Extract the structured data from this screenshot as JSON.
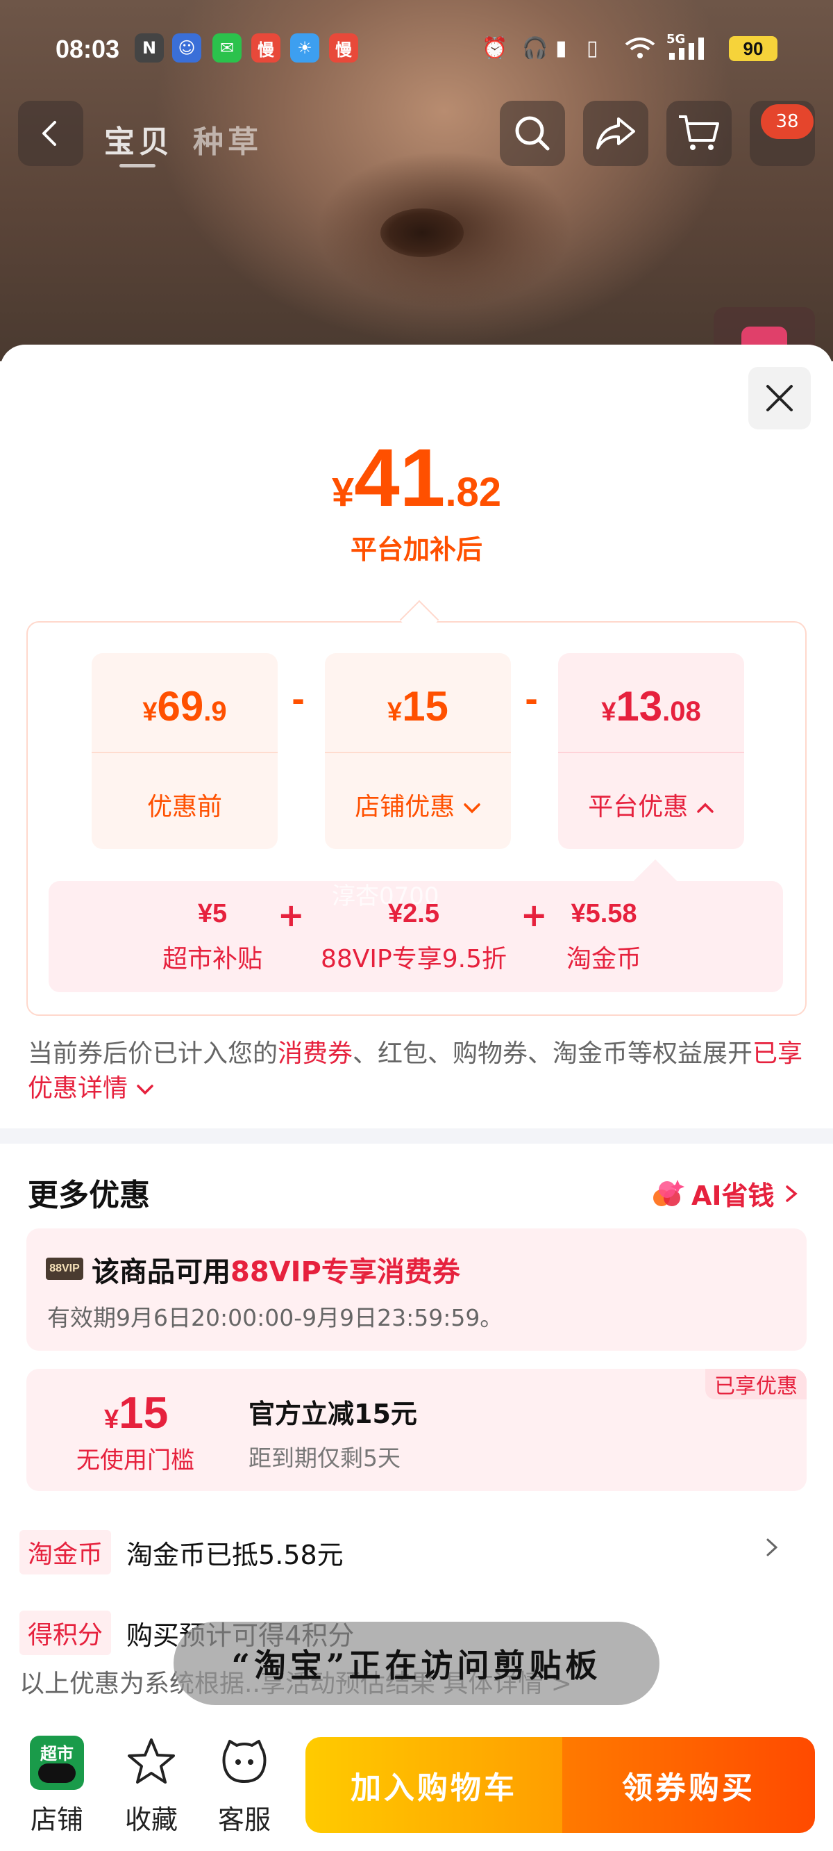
{
  "status_bar": {
    "time": "08:03",
    "app_icons": [
      "nfc-icon",
      "kids-app-icon",
      "wechat-icon",
      "manman-app-icon",
      "weather-icon",
      "manman-app-icon"
    ],
    "battery": "90",
    "network": "5G"
  },
  "header": {
    "tabs": [
      {
        "label": "宝贝",
        "active": true
      },
      {
        "label": "种草",
        "active": false
      }
    ],
    "cart_badge": "38"
  },
  "price": {
    "currency": "¥",
    "integer": "41",
    "decimal": ".82",
    "subtitle": "平台加补后"
  },
  "breakdown": {
    "cards": [
      {
        "currency": "¥",
        "integer": "69",
        "decimal": ".9",
        "label": "优惠前"
      },
      {
        "currency": "¥",
        "integer": "15",
        "decimal": "",
        "label": "店铺优惠"
      },
      {
        "currency": "¥",
        "integer": "13",
        "decimal": ".08",
        "label": "平台优惠"
      }
    ],
    "operator": "-",
    "subsidies": [
      {
        "value": "¥5",
        "name": "超市补贴"
      },
      {
        "value": "¥2.5",
        "name": "88VIP专享9.5折"
      },
      {
        "value": "¥5.58",
        "name": "淘金币"
      }
    ],
    "plus": "+",
    "watermark": "淳杏0700"
  },
  "note": {
    "part1": "当前券后价已计入您的",
    "highlight1": "消费券",
    "part2": "、红包、购物券、淘金币等权益展开",
    "highlight2": "已享优惠详情"
  },
  "more": {
    "title": "更多优惠",
    "ai_label": "AI省钱",
    "vip_badge": "88VIP",
    "vip_title_prefix": "该商品可用",
    "vip_title_highlight": "88VIP专享消费券",
    "vip_validity": "有效期9月6日20:00:00-9月9日23:59:59。",
    "coupon": {
      "currency": "¥",
      "amount": "15",
      "condition": "无使用门槛",
      "title": "官方立减15元",
      "expiry": "距到期仅剩5天",
      "tag": "已享优惠"
    },
    "rows": [
      {
        "tag": "淘金币",
        "text": "淘金币已抵5.58元"
      },
      {
        "tag": "得积分",
        "text": "购买预计可得4积分"
      }
    ],
    "footnote": "以上优惠为系统根据..享活动预估结果 具体详情 >"
  },
  "toast": "“淘宝”正在访问剪贴板",
  "bottom_bar": {
    "items": [
      {
        "label": "店铺",
        "icon": "tmall-supermarket-icon",
        "icon_text": "超市"
      },
      {
        "label": "收藏",
        "icon": "star-icon"
      },
      {
        "label": "客服",
        "icon": "customer-service-icon"
      }
    ],
    "add_to_cart": "加入购物车",
    "buy": "领券购买"
  },
  "colors": {
    "accent_orange": "#ff5000",
    "accent_red": "#e6213d",
    "cart_button": "#ffb000",
    "buy_button": "#ff5a00"
  }
}
